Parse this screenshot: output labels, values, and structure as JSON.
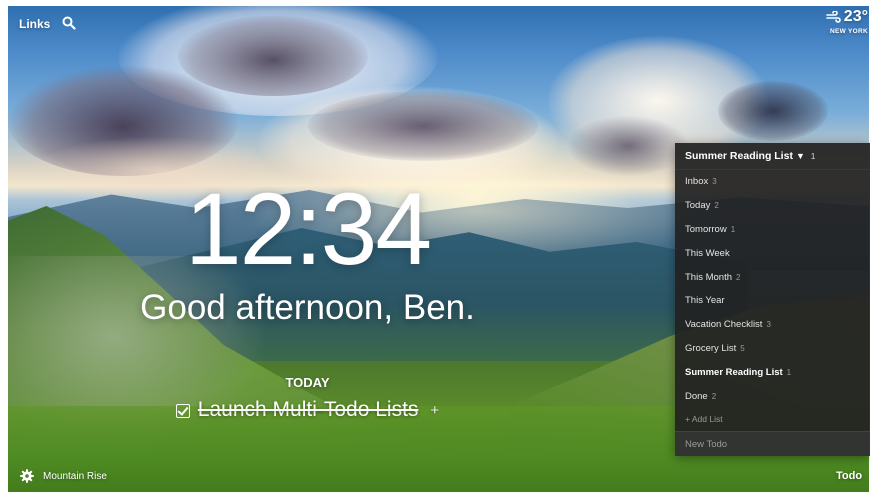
{
  "top_bar": {
    "links_label": "Links",
    "search_icon": "search-icon"
  },
  "weather": {
    "icon": "wind-icon",
    "temperature": "23°",
    "location": "NEW YORK"
  },
  "clock": {
    "time": "12:34"
  },
  "greeting": {
    "text": "Good afternoon, Ben."
  },
  "focus": {
    "label": "TODAY",
    "task": "Launch Multi-Todo Lists",
    "completed": true,
    "add_symbol": "+"
  },
  "footer": {
    "settings_icon": "gear-icon",
    "photo_credit": "Mountain Rise",
    "todo_button": "Todo"
  },
  "todo_panel": {
    "selected_list": "Summer Reading List",
    "selected_count": "1",
    "lists": [
      {
        "label": "Inbox",
        "count": "3"
      },
      {
        "label": "Today",
        "count": "2"
      },
      {
        "label": "Tomorrow",
        "count": "1"
      },
      {
        "label": "This Week",
        "count": ""
      },
      {
        "label": "This Month",
        "count": "2"
      },
      {
        "label": "This Year",
        "count": ""
      },
      {
        "label": "Vacation Checklist",
        "count": "3"
      },
      {
        "label": "Grocery List",
        "count": "5"
      },
      {
        "label": "Summer Reading List",
        "count": "1"
      },
      {
        "label": "Done",
        "count": "2"
      }
    ],
    "add_list_label": "+ Add List",
    "new_todo_placeholder": "New Todo"
  }
}
